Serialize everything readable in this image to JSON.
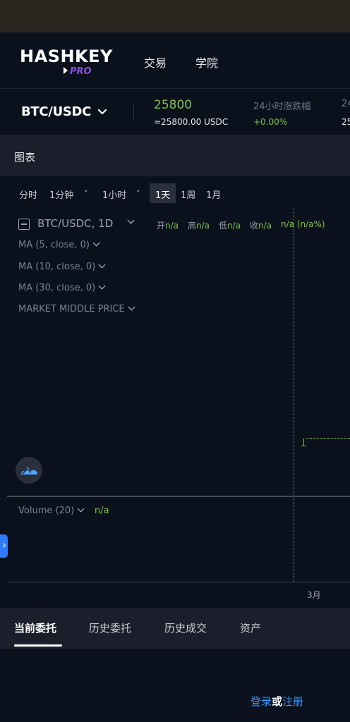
{
  "brand": {
    "name": "HASHKEY",
    "sub": "PRO"
  },
  "nav": {
    "trade": "交易",
    "academy": "学院"
  },
  "ticker": {
    "pair": "BTC/USDC",
    "last_price": "25800",
    "last_price_usd": "≈25800.00 USDC",
    "change_label": "24小时涨跌幅",
    "change_value": "+0.00%",
    "next_label_partial": "24",
    "next_value_partial": "25"
  },
  "section": {
    "title": "图表"
  },
  "intervals": {
    "time": "分时",
    "min": "1分钟",
    "hour": "1小时",
    "day": "1天",
    "week": "1周",
    "month": "1月",
    "chevron": "˅"
  },
  "legend": {
    "symbol": "BTC/USDC, 1D",
    "open_label": "开",
    "open": "n/a",
    "high_label": "高",
    "high": "n/a",
    "low_label": "低",
    "low": "n/a",
    "close_label": "收",
    "close": "n/a",
    "change": "n/a (n/a%)"
  },
  "indicators": {
    "ma5": "MA (5, close, 0)",
    "ma10": "MA (10, close, 0)",
    "ma30": "MA (30, close, 0)",
    "market_mid": "MARKET MIDDLE PRICE"
  },
  "volume": {
    "label": "Volume (20)",
    "value": "n/a"
  },
  "time_axis": {
    "label": "3月"
  },
  "orders": {
    "tabs": [
      "当前委托",
      "历史委托",
      "历史成交",
      "资产"
    ],
    "active_tab": 0,
    "login": "登录",
    "or": "或",
    "register": "注册"
  },
  "colors": {
    "background": "#0b101d",
    "panel": "#1b1f2b",
    "up_green": "#7fc34a",
    "brand_purple": "#8a4ee0",
    "link_blue": "#2f9bff",
    "handle_blue": "#2f7bff"
  },
  "icons": {
    "pair_dropdown": "chevron-down-icon",
    "tv_badge": "tradingview-logo-icon",
    "side_handle": "chevron-right-icon",
    "legend_collapse": "collapse-minus-icon"
  }
}
